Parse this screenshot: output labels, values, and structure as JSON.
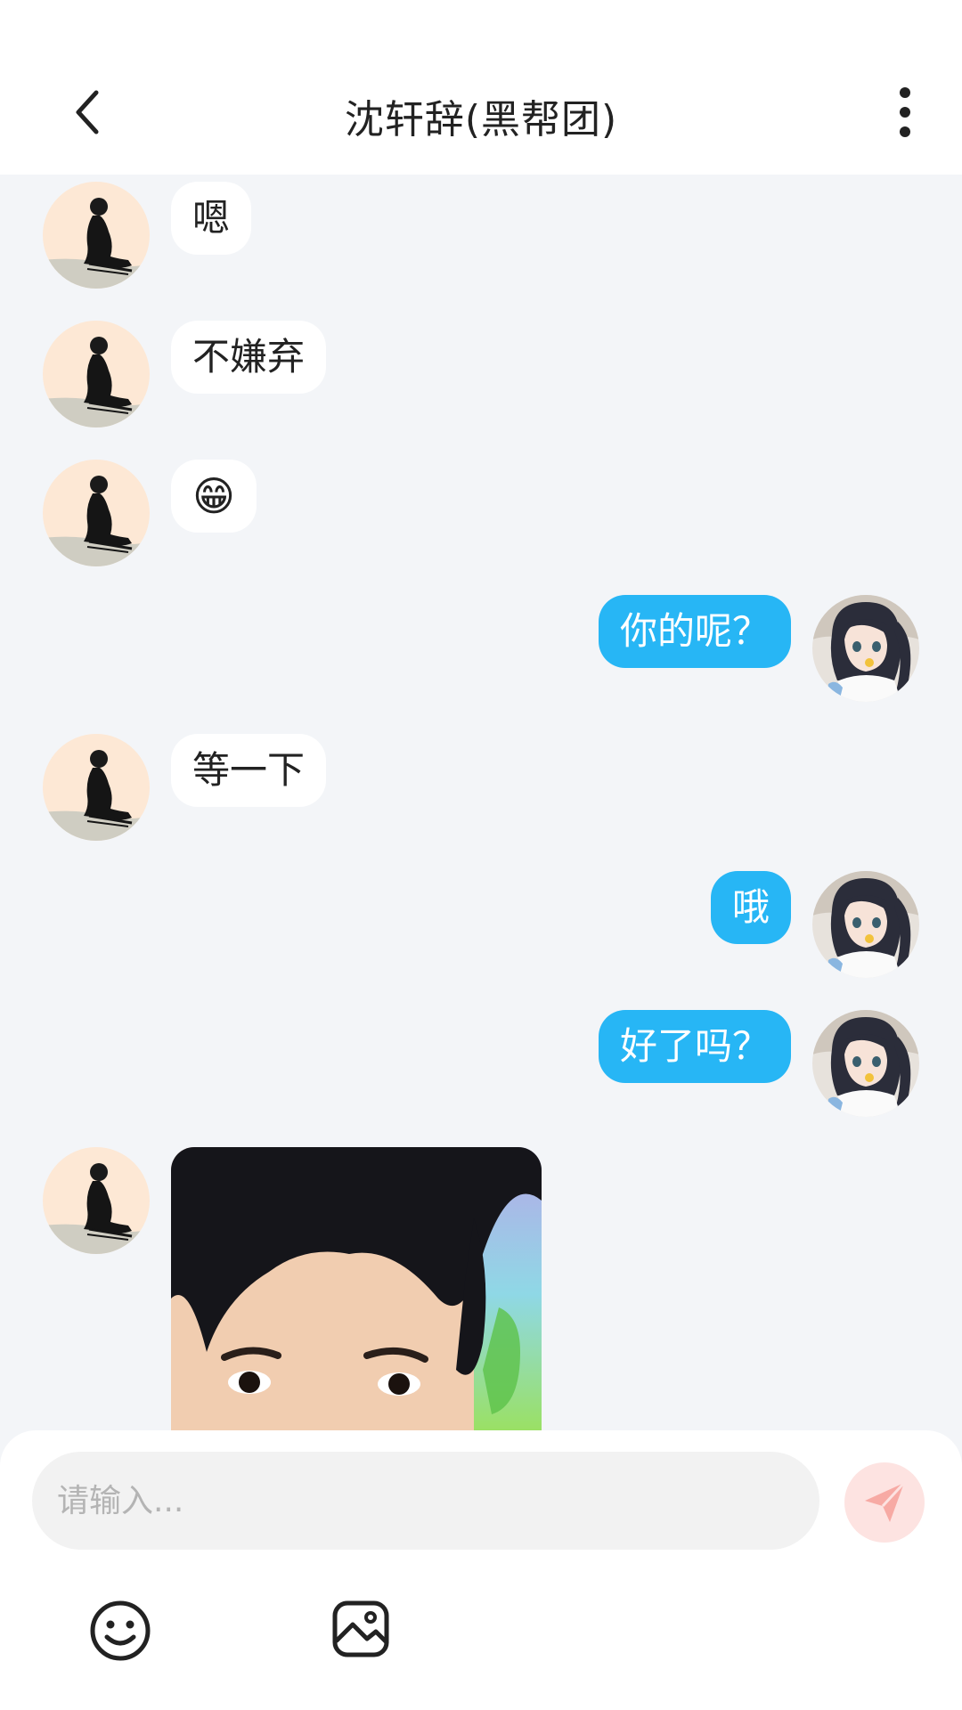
{
  "header": {
    "title": "沈轩辞(黑帮团)",
    "back_icon": "chevron-left-icon",
    "more_icon": "more-vertical-icon"
  },
  "messages": [
    {
      "side": "left",
      "text": "嗯"
    },
    {
      "side": "left",
      "text": "不嫌弃"
    },
    {
      "side": "left",
      "text": "😁"
    },
    {
      "side": "right",
      "text": "你的呢？"
    },
    {
      "side": "left",
      "text": "等一下"
    },
    {
      "side": "right",
      "text": "哦"
    },
    {
      "side": "right",
      "text": "好了吗？"
    },
    {
      "side": "left",
      "type": "image"
    }
  ],
  "input": {
    "placeholder": "请输入...",
    "value": ""
  },
  "toolbar": {
    "emoji_icon": "smiley-icon",
    "image_icon": "image-icon",
    "send_icon": "paper-plane-icon"
  },
  "colors": {
    "outgoing_bubble": "#27b6f5",
    "incoming_bubble": "#ffffff",
    "background": "#f3f5f8",
    "send_button": "#fde3e1",
    "send_icon": "#f59a93"
  }
}
